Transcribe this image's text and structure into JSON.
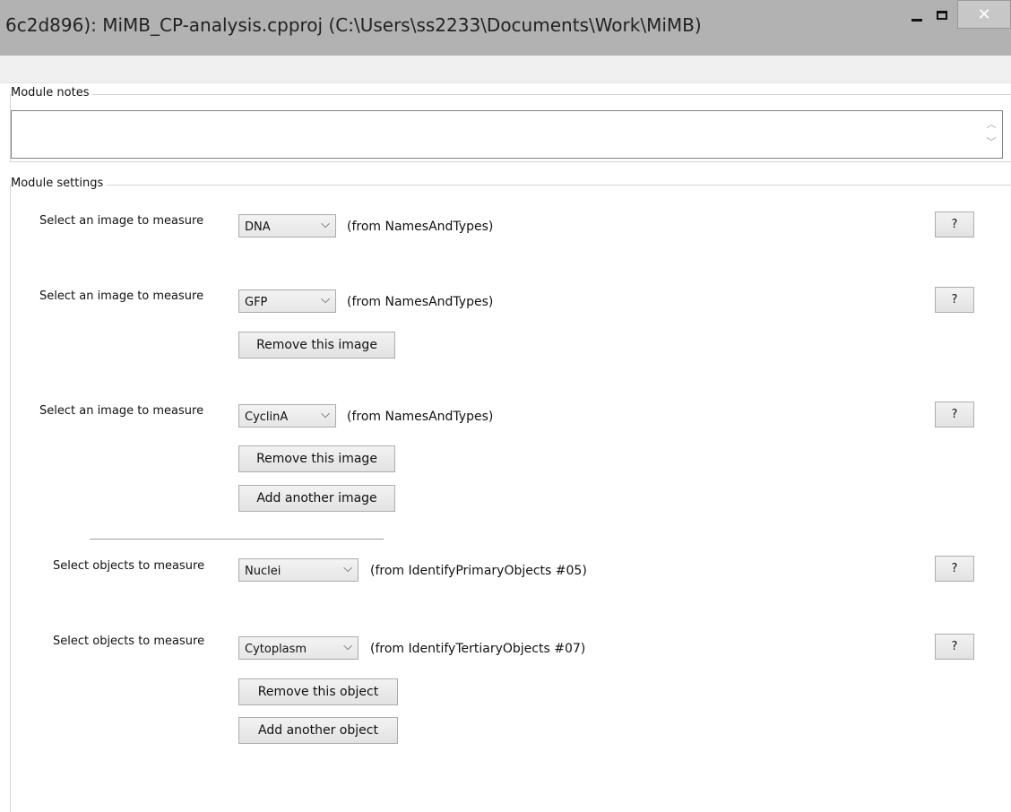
{
  "window": {
    "title": "6c2d896): MiMB_CP-analysis.cpproj (C:\\Users\\ss2233\\Documents\\Work\\MiMB)",
    "minimize_glyph": "–",
    "maximize_glyph": "□",
    "close_glyph": "✕"
  },
  "notes": {
    "label": "Module notes",
    "value": ""
  },
  "settings": {
    "label": "Module settings",
    "images": [
      {
        "label": "Select an image to measure",
        "value": "DNA",
        "source": "(from NamesAndTypes)"
      },
      {
        "label": "Select an image to measure",
        "value": "GFP",
        "source": "(from NamesAndTypes)"
      },
      {
        "label": "Select an image to measure",
        "value": "CyclinA",
        "source": "(from NamesAndTypes)"
      }
    ],
    "remove_image_label": "Remove this image",
    "add_image_label": "Add another image",
    "objects": [
      {
        "label": "Select objects to measure",
        "value": "Nuclei",
        "source": "(from IdentifyPrimaryObjects #05)"
      },
      {
        "label": "Select objects to measure",
        "value": "Cytoplasm",
        "source": "(from IdentifyTertiaryObjects #07)"
      }
    ],
    "remove_object_label": "Remove this object",
    "add_object_label": "Add another object",
    "help_label": "?"
  }
}
